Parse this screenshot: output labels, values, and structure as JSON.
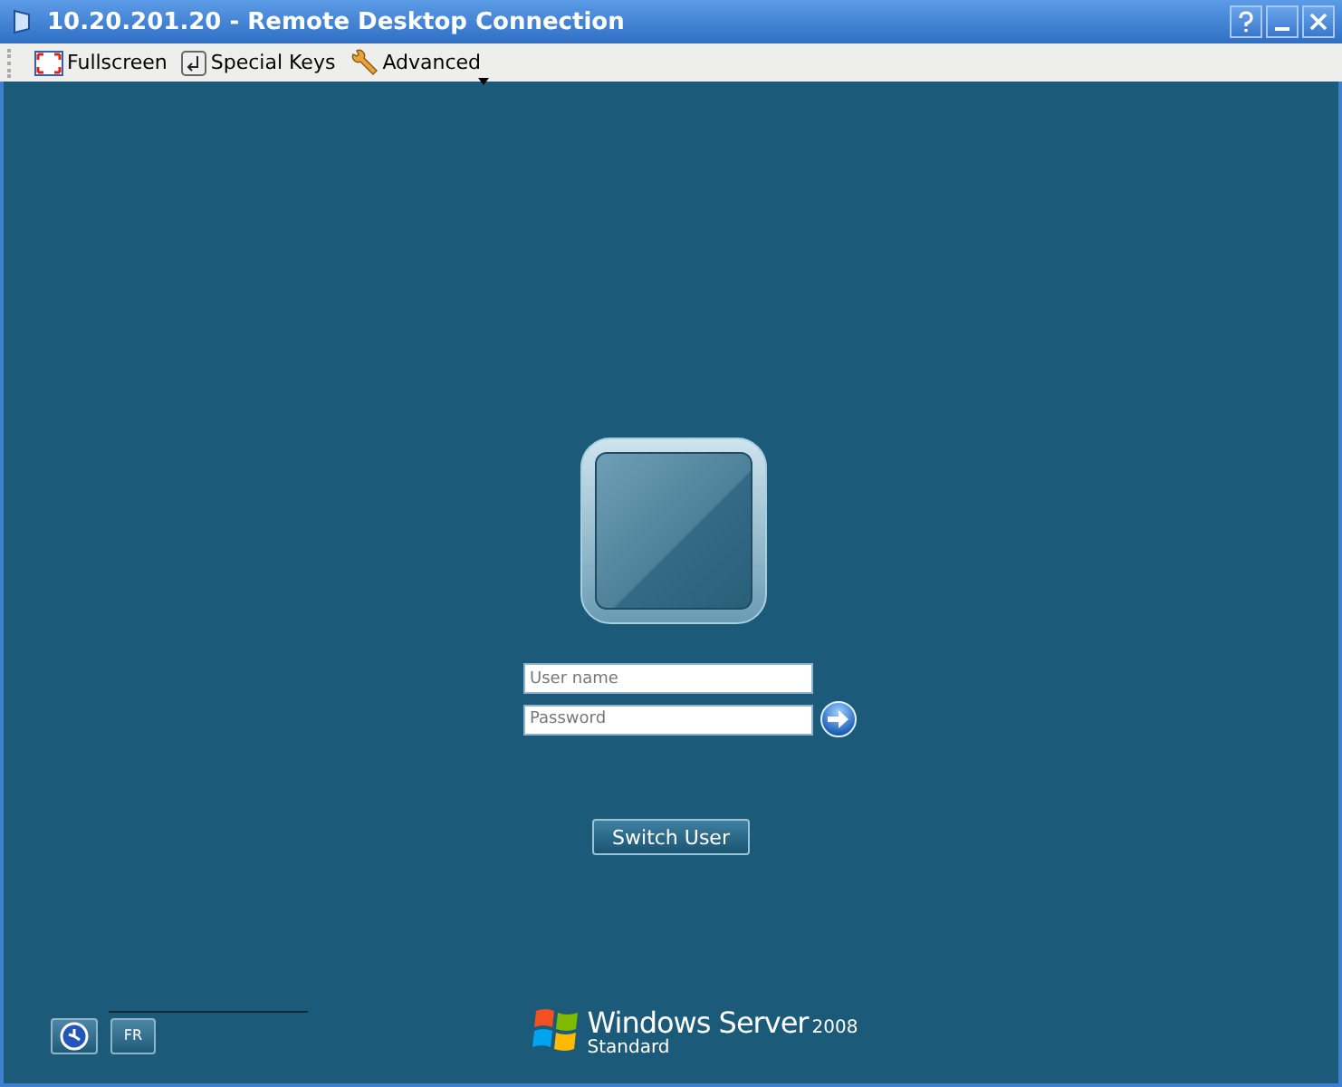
{
  "window": {
    "title": "10.20.201.20 - Remote Desktop Connection"
  },
  "toolbar": [
    {
      "label": "Fullscreen",
      "kind": "fullscreen"
    },
    {
      "label": "Special Keys",
      "kind": "keys"
    },
    {
      "label": "Advanced",
      "kind": "advanced"
    }
  ],
  "login": {
    "username": {
      "placeholder": "User name"
    },
    "password": {
      "placeholder": "Password"
    },
    "switch_button": "Switch User"
  },
  "bottom": {
    "language": "FR"
  },
  "brand": {
    "name": "Windows Server",
    "version": "2008",
    "edition": "Standard"
  }
}
